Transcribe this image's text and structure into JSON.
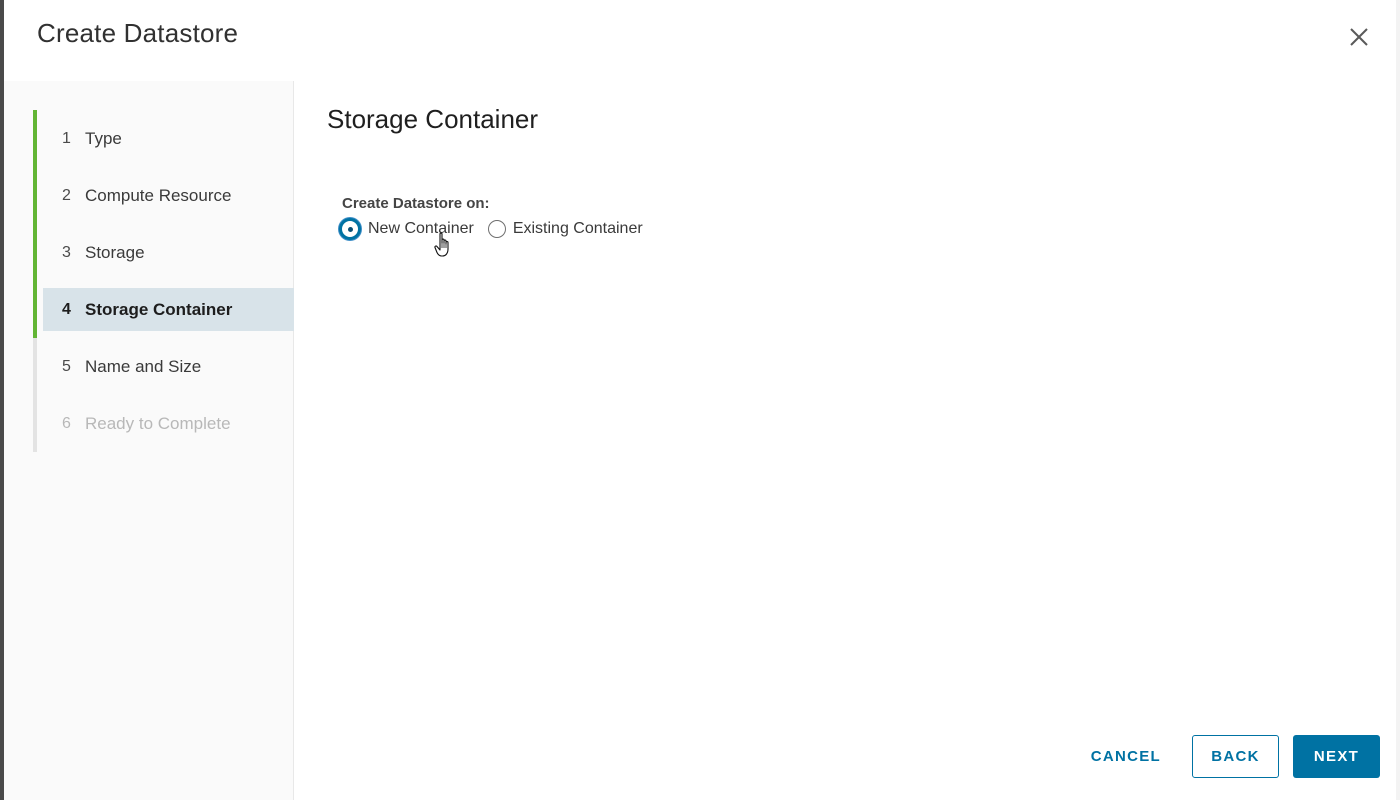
{
  "dialog": {
    "title": "Create Datastore"
  },
  "steps": [
    {
      "num": "1",
      "label": "Type",
      "state": "done"
    },
    {
      "num": "2",
      "label": "Compute Resource",
      "state": "done"
    },
    {
      "num": "3",
      "label": "Storage",
      "state": "done"
    },
    {
      "num": "4",
      "label": "Storage Container",
      "state": "current"
    },
    {
      "num": "5",
      "label": "Name and Size",
      "state": "pending"
    },
    {
      "num": "6",
      "label": "Ready to Complete",
      "state": "disabled"
    }
  ],
  "content": {
    "title": "Storage Container",
    "field_label": "Create Datastore on:",
    "options": [
      {
        "label": "New Container",
        "selected": true
      },
      {
        "label": "Existing Container",
        "selected": false
      }
    ]
  },
  "footer": {
    "cancel_label": "CANCEL",
    "back_label": "BACK",
    "next_label": "NEXT"
  },
  "colors": {
    "accent": "#0072a3",
    "step_complete": "#62b534",
    "step_current_bg": "#d8e3e9"
  }
}
